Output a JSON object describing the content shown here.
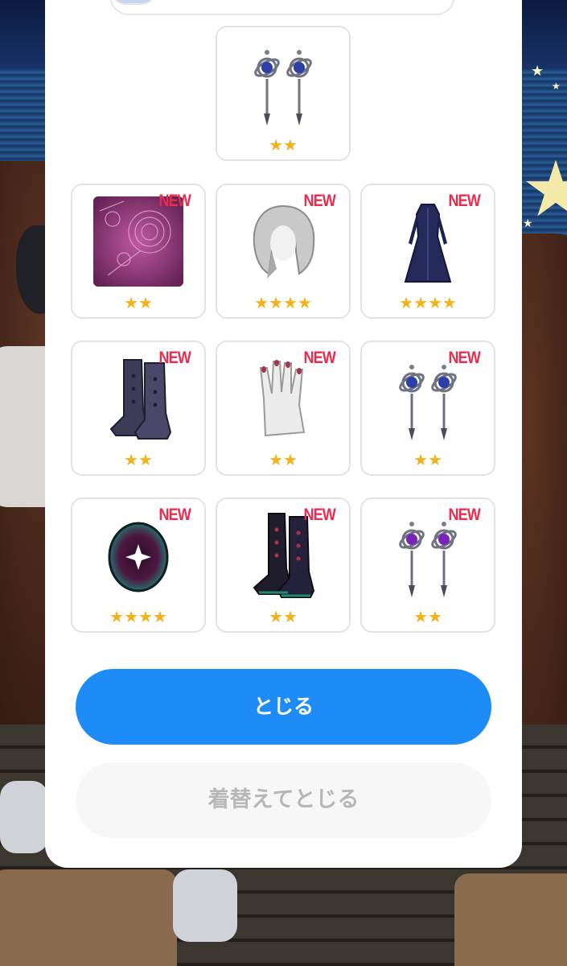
{
  "items": [
    {
      "name": "earrings-blue-icon",
      "stars": "★★",
      "new": ""
    },
    {
      "name": "galaxy-background-icon",
      "stars": "★★",
      "new": "NEW"
    },
    {
      "name": "silver-hair-icon",
      "stars": "★★★★",
      "new": "NEW"
    },
    {
      "name": "navy-dress-icon",
      "stars": "★★★★",
      "new": "NEW"
    },
    {
      "name": "dark-boots-icon",
      "stars": "★★",
      "new": "NEW"
    },
    {
      "name": "hand-nails-icon",
      "stars": "★★",
      "new": "NEW"
    },
    {
      "name": "earrings-blue-icon",
      "stars": "★★",
      "new": "NEW"
    },
    {
      "name": "zodiac-eye-icon",
      "stars": "★★★★",
      "new": "NEW"
    },
    {
      "name": "black-boots-icon",
      "stars": "★★",
      "new": "NEW"
    },
    {
      "name": "earrings-purple-icon",
      "stars": "★★",
      "new": "NEW"
    }
  ],
  "buttons": {
    "close_label": "とじる",
    "change_and_close_label": "着替えてとじる"
  },
  "colors": {
    "primary": "#1e8cf6",
    "new_badge": "#ea2c4e",
    "star": "#f2b21b"
  }
}
